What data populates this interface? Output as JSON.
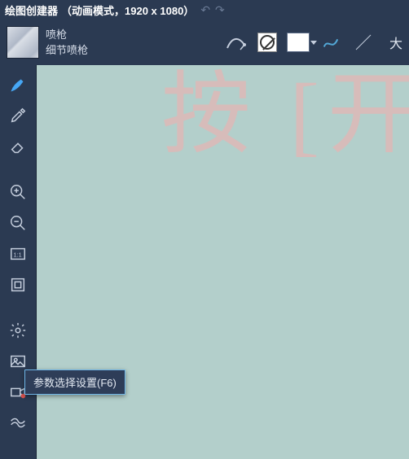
{
  "titlebar": {
    "title": "绘图创建器",
    "subtitle": "（动画模式，1920 x 1080）"
  },
  "toolbar": {
    "brush_name": "喷枪",
    "brush_sub": "细节喷枪",
    "right_label": "大"
  },
  "sidebar": {
    "items": [
      {
        "name": "brush-tool"
      },
      {
        "name": "eyedropper-tool"
      },
      {
        "name": "eraser-tool"
      },
      {
        "name": "zoom-in-tool"
      },
      {
        "name": "zoom-out-tool"
      },
      {
        "name": "actual-size-tool",
        "label": "1:1"
      },
      {
        "name": "fit-screen-tool"
      },
      {
        "name": "settings-tool"
      },
      {
        "name": "image-tool"
      },
      {
        "name": "record-tool"
      },
      {
        "name": "effects-tool"
      }
    ]
  },
  "canvas": {
    "watermark": "按 [开"
  },
  "tooltip": {
    "text": "参数选择设置(F6)"
  }
}
